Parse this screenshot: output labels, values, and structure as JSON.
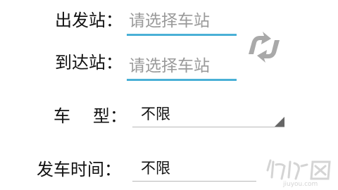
{
  "form": {
    "departure": {
      "label": "出发站：",
      "placeholder": "请选择车站"
    },
    "arrival": {
      "label": "到达站：",
      "placeholder": "请选择车站"
    },
    "train_type": {
      "label_char1": "车",
      "label_char2": "型：",
      "value": "不限"
    },
    "departure_time": {
      "label": "发车时间：",
      "value": "不限"
    }
  },
  "icons": {
    "swap": "swap-stations-icon"
  },
  "colors": {
    "input_underline": "#4ab0d6",
    "placeholder": "#9a9a9a",
    "swap_icon": "#a9a9a9",
    "text": "#111111"
  },
  "watermark": {
    "text": "jiuyou.com"
  }
}
